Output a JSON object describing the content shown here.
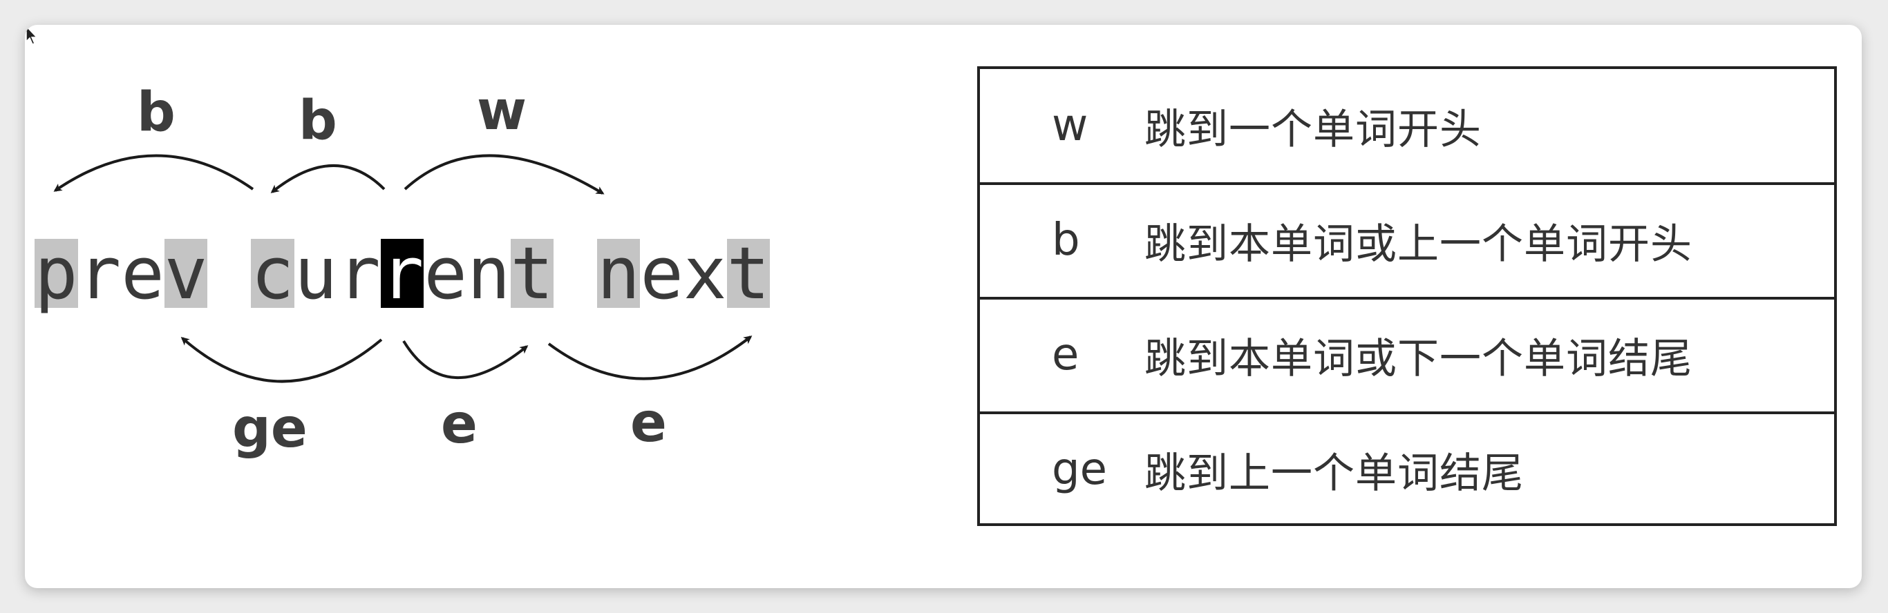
{
  "diagram": {
    "words": [
      {
        "text": "prev",
        "highlight": [
          0,
          3
        ]
      },
      {
        "text": "current",
        "highlight": [
          0,
          6
        ],
        "cursor": 3
      },
      {
        "text": "next",
        "highlight": [
          0,
          3
        ]
      }
    ],
    "top_labels": [
      "b",
      "b",
      "w"
    ],
    "bottom_labels": [
      "ge",
      "e",
      "e"
    ]
  },
  "table": {
    "rows": [
      {
        "key": "w",
        "desc": "跳到一个单词开头"
      },
      {
        "key": "b",
        "desc": "跳到本单词或上一个单词开头"
      },
      {
        "key": "e",
        "desc": "跳到本单词或下一个单词结尾"
      },
      {
        "key": "ge",
        "desc": "跳到上一个单词结尾"
      }
    ]
  }
}
